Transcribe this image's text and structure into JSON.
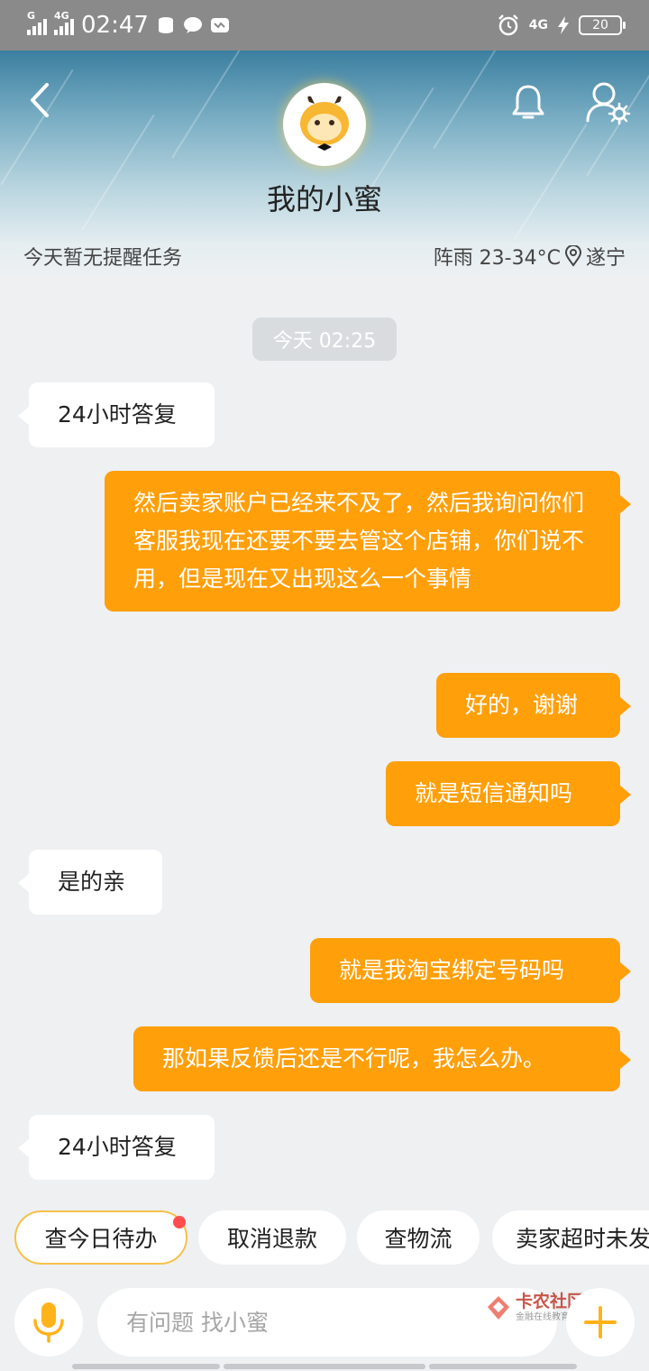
{
  "status_bar": {
    "network_1": "G",
    "network_2": "4G",
    "time": "02:47",
    "right_network": "4G",
    "battery": "20"
  },
  "header": {
    "title": "我的小蜜",
    "reminder": "今天暂无提醒任务",
    "weather": "阵雨 23-34°C",
    "city": "遂宁"
  },
  "chat": {
    "timestamp": "今天 02:25",
    "messages": [
      {
        "side": "in",
        "text": "24小时答复"
      },
      {
        "side": "out",
        "text": "然后卖家账户已经来不及了，然后我询问你们客服我现在还要不要去管这个店铺，你们说不用，但是现在又出现这么一个事情"
      },
      {
        "side": "out",
        "text": "好的，谢谢"
      },
      {
        "side": "out",
        "text": "就是短信通知吗"
      },
      {
        "side": "in",
        "text": "是的亲"
      },
      {
        "side": "out",
        "text": "就是我淘宝绑定号码吗"
      },
      {
        "side": "out",
        "text": "那如果反馈后还是不行呢，我怎么办。"
      },
      {
        "side": "in",
        "text": "24小时答复"
      }
    ]
  },
  "quick_actions": [
    "查今日待办",
    "取消退款",
    "查物流",
    "卖家超时未发货"
  ],
  "composer": {
    "placeholder": "有问题 找小蜜"
  },
  "watermark": {
    "title": "卡农社区",
    "subtitle": "金融在线教育"
  },
  "colors": {
    "accent": "#ff9f0a",
    "highlight": "#f6c14a"
  }
}
